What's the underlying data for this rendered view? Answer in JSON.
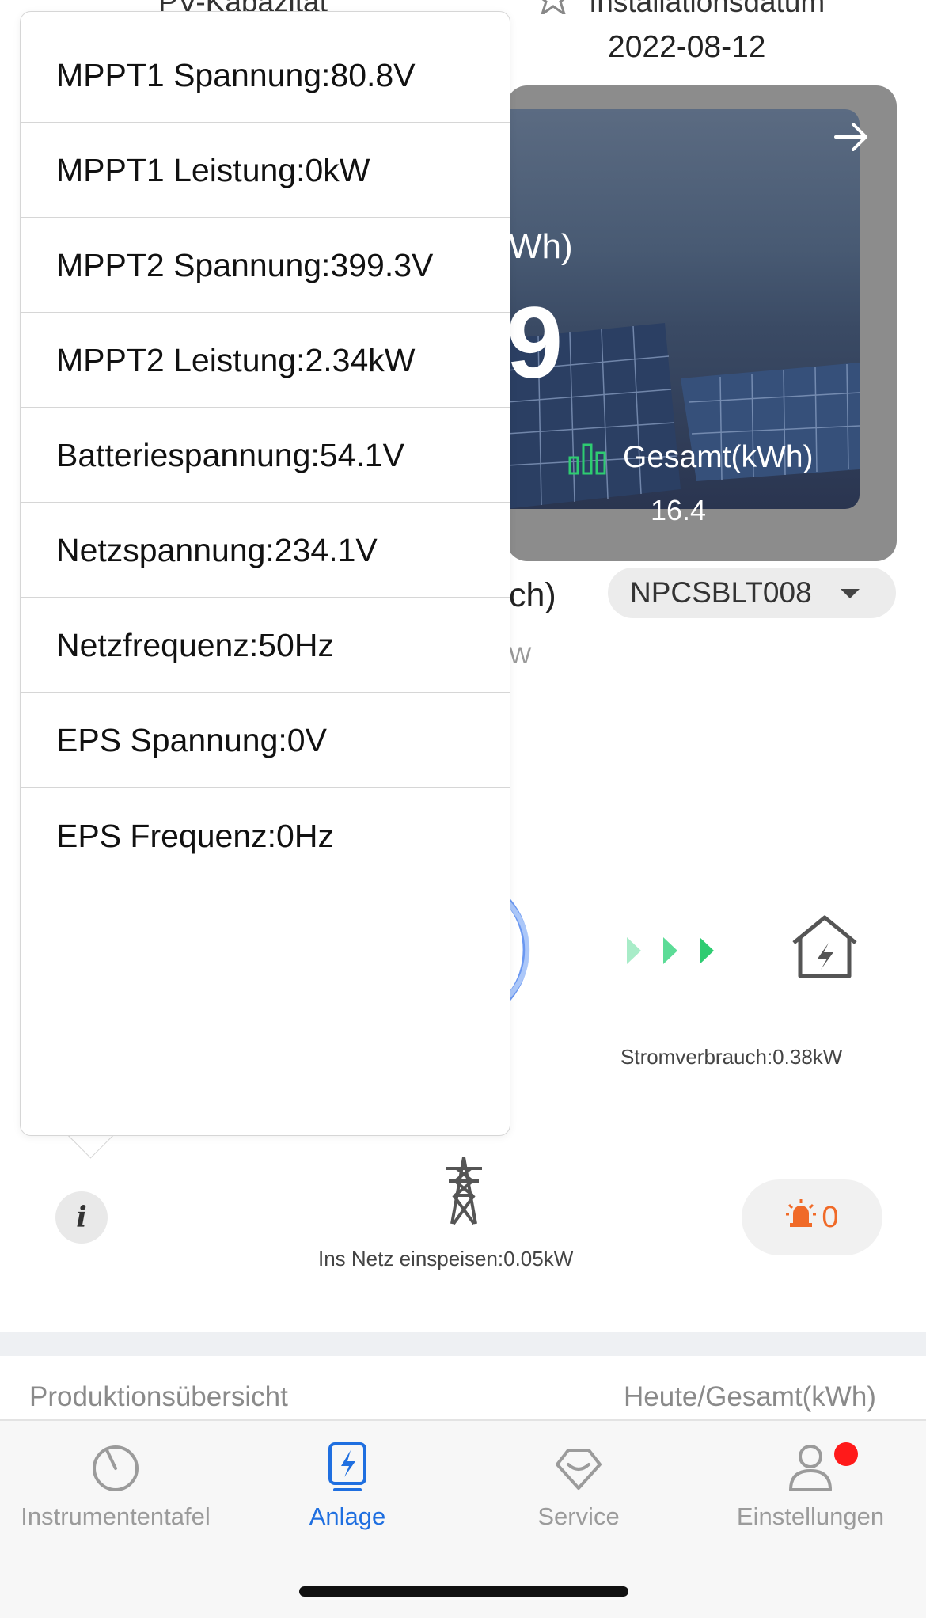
{
  "header": {
    "pv_capacity_label": "PV-Kapazität",
    "install_date_label": "Installationsdatum",
    "install_date_value": "2022-08-12"
  },
  "hero": {
    "unit_fragment": "Wh)",
    "value_fragment": "9",
    "total_label": "Gesamt(kWh)",
    "total_value": "16.4"
  },
  "device": {
    "unit_fragment": "ch)",
    "serial": "NPCSBLT008",
    "w_fragment": "W"
  },
  "flow": {
    "consumption_label": "Stromverbrauch:0.38kW",
    "grid_feed_label": "Ins Netz einspeisen:0.05kW",
    "alarm_count": "0"
  },
  "popover": {
    "items": [
      "MPPT1 Spannung:80.8V",
      "MPPT1 Leistung:0kW",
      "MPPT2 Spannung:399.3V",
      "MPPT2 Leistung:2.34kW",
      "Batteriespannung:54.1V",
      "Netzspannung:234.1V",
      "Netzfrequenz:50Hz",
      "EPS Spannung:0V",
      "EPS Frequenz:0Hz"
    ]
  },
  "info_button": "i",
  "production": {
    "title": "Produktionsübersicht",
    "unit": "Heute/Gesamt(kWh)"
  },
  "tabs": [
    {
      "label": "Instrumententafel",
      "icon": "dashboard-gauge-icon",
      "active": false
    },
    {
      "label": "Anlage",
      "icon": "plant-lightning-icon",
      "active": true
    },
    {
      "label": "Service",
      "icon": "service-heart-icon",
      "active": false
    },
    {
      "label": "Einstellungen",
      "icon": "person-icon",
      "active": false,
      "badge": true
    }
  ],
  "colors": {
    "accent": "#1f6fe0",
    "alarm": "#f06a28",
    "flow_arrow": "#2ecc71",
    "badge": "#ff1a1a"
  }
}
